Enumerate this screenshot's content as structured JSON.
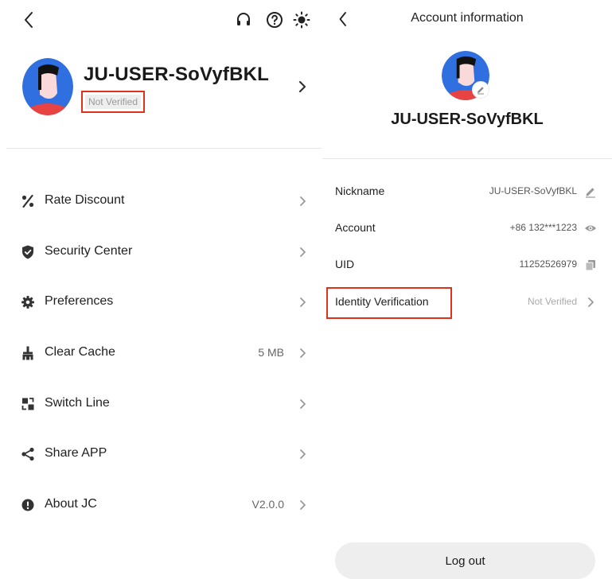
{
  "profile_screen": {
    "username": "JU-USER-SoVyfBKL",
    "verification_status": "Not Verified",
    "header_icons": [
      "back-icon",
      "headset-icon",
      "help-icon",
      "sun-icon"
    ],
    "menu": [
      {
        "label": "Rate Discount",
        "value": "",
        "icon": "percent-icon",
        "name": "rate-discount"
      },
      {
        "label": "Security Center",
        "value": "",
        "icon": "shield-check-icon",
        "name": "security-center"
      },
      {
        "label": "Preferences",
        "value": "",
        "icon": "gear-icon",
        "name": "preferences"
      },
      {
        "label": "Clear Cache",
        "value": "5 MB",
        "icon": "broom-icon",
        "name": "clear-cache"
      },
      {
        "label": "Switch Line",
        "value": "",
        "icon": "switch-icon",
        "name": "switch-line"
      },
      {
        "label": "Share APP",
        "value": "",
        "icon": "share-icon",
        "name": "share-app"
      },
      {
        "label": "About JC",
        "value": "V2.0.0",
        "icon": "info-icon",
        "name": "about-jc"
      }
    ]
  },
  "account_screen": {
    "title": "Account information",
    "username": "JU-USER-SoVyfBKL",
    "rows": [
      {
        "label": "Nickname",
        "value": "JU-USER-SoVyfBKL",
        "icon": "pencil-icon",
        "name": "nickname"
      },
      {
        "label": "Account",
        "value": "+86 132***1223",
        "icon": "eye-icon",
        "name": "account"
      },
      {
        "label": "UID",
        "value": "11252526979",
        "icon": "copy-icon",
        "name": "uid"
      },
      {
        "label": "Identity Verification",
        "value": "Not Verified",
        "icon": "chevron-right-icon",
        "name": "identity-verification"
      }
    ],
    "logout_label": "Log out"
  },
  "colors": {
    "highlight_border": "#e0301e",
    "avatar_blue": "#2f6fe0",
    "avatar_red": "#e84343",
    "muted_text": "#aaaaaa"
  }
}
